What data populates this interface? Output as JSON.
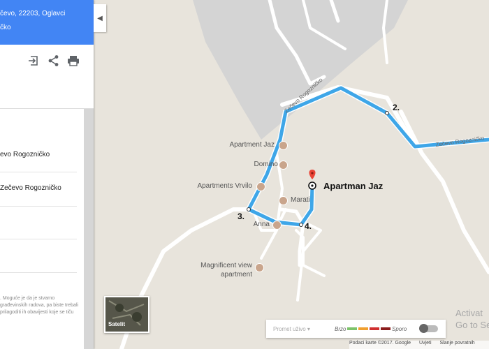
{
  "panel": {
    "header_line1": "čevo, 22203, Oglavci",
    "header_line2": "čko",
    "icons": [
      "sign-in-icon",
      "share-icon",
      "print-icon"
    ],
    "rows": [
      {
        "label": "evo Rogozničko"
      },
      {
        "label": "Zečevo Rogozničko"
      }
    ],
    "notice": ". Moguće je da je stvarno građevinskih radova, pa biste trebali prilagoditi ih obavijesti koje se tiču"
  },
  "map": {
    "roads": [
      "Zečevo Rogozničko",
      "Zečevo Rogozničko"
    ],
    "pois": [
      {
        "name": "Apartment Jaz"
      },
      {
        "name": "Domino"
      },
      {
        "name": "Apartments Vrvilo"
      },
      {
        "name": "Marati"
      },
      {
        "name": "Anna"
      },
      {
        "name": "Magnificent view apartment"
      }
    ],
    "steps": [
      "2.",
      "3.",
      "4."
    ],
    "destination": "Apartman Jaz",
    "route_color": "#3ea6e8",
    "pin_color": "#ea4335"
  },
  "satellite": {
    "label": "Satelit"
  },
  "traffic": {
    "live": "Promet uživo ▾",
    "fast": "Brzo",
    "slow": "Sporo",
    "colors": [
      "#7cc36a",
      "#f0a030",
      "#d03030",
      "#8b1c1c"
    ]
  },
  "footer": {
    "data": "Podaci karte ©2017. Google",
    "terms": "Uvjeti",
    "feedback": "Slanje povratnih"
  },
  "watermark": {
    "line1": "Activat",
    "line2": "Go to Se"
  }
}
